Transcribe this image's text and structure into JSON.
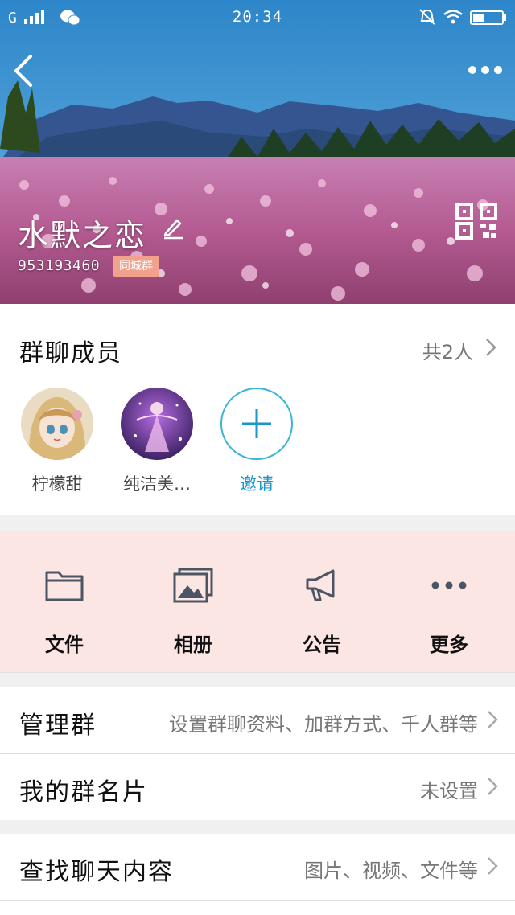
{
  "status_bar": {
    "signal": "G",
    "time": "20:34"
  },
  "header": {
    "group_name": "水默之恋",
    "group_id": "953193460",
    "group_tag": "同城群"
  },
  "members": {
    "title": "群聊成员",
    "count": "共2人",
    "items": [
      {
        "name": "柠檬甜"
      },
      {
        "name": "纯洁美…"
      }
    ],
    "invite_label": "邀请"
  },
  "actions": [
    {
      "label": "文件",
      "icon": "folder-icon"
    },
    {
      "label": "相册",
      "icon": "album-icon"
    },
    {
      "label": "公告",
      "icon": "megaphone-icon"
    },
    {
      "label": "更多",
      "icon": "ellipsis-icon"
    }
  ],
  "settings": [
    {
      "label": "管理群",
      "value": "设置群聊资料、加群方式、千人群等"
    },
    {
      "label": "我的群名片",
      "value": "未设置"
    },
    {
      "label": "查找聊天内容",
      "value": "图片、视频、文件等"
    }
  ],
  "colors": {
    "accent": "#1a96c7",
    "tag_bg": "#f2a18d",
    "actions_bg": "#fce6e4"
  }
}
